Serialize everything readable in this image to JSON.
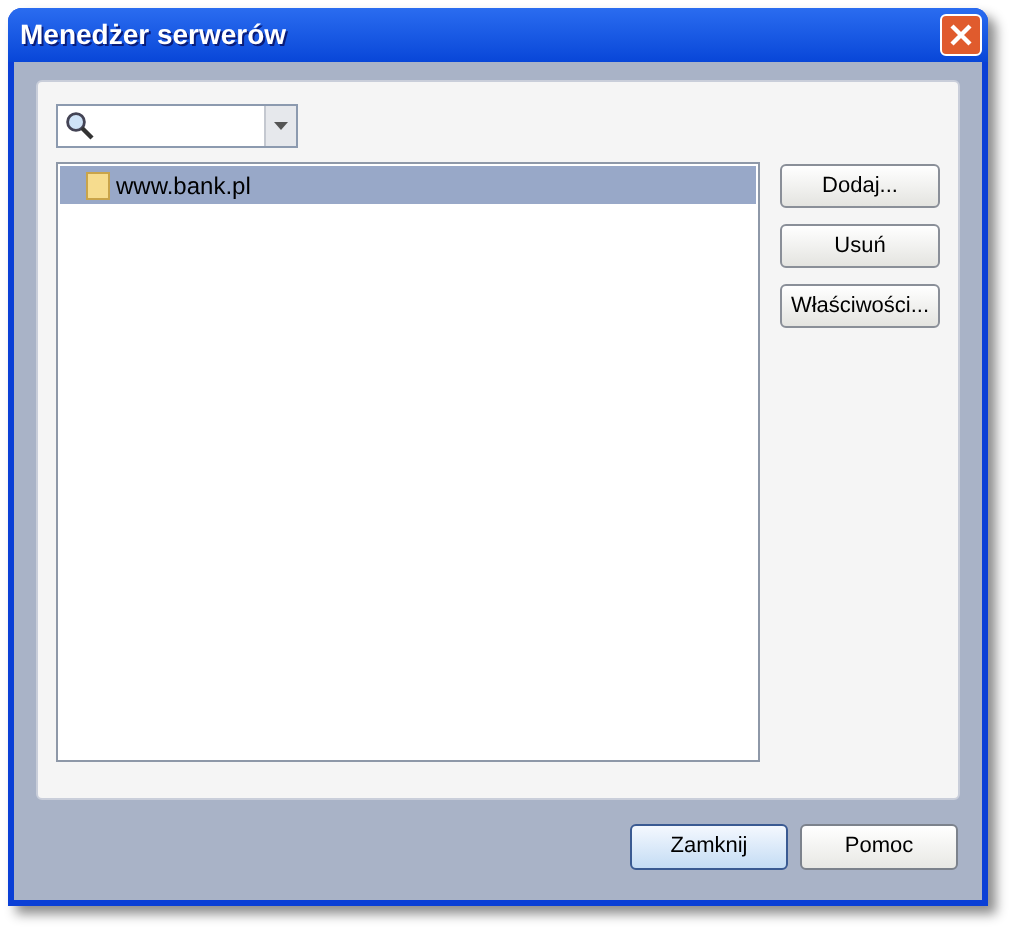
{
  "window": {
    "title": "Menedżer serwerów"
  },
  "servers": [
    {
      "label": "www.bank.pl",
      "selected": true
    }
  ],
  "side_buttons": [
    {
      "label": "Dodaj..."
    },
    {
      "label": "Usuń"
    },
    {
      "label": "Właściwości..."
    }
  ],
  "footer_buttons": [
    {
      "label": "Zamknij",
      "default": true
    },
    {
      "label": "Pomoc",
      "default": false
    }
  ]
}
